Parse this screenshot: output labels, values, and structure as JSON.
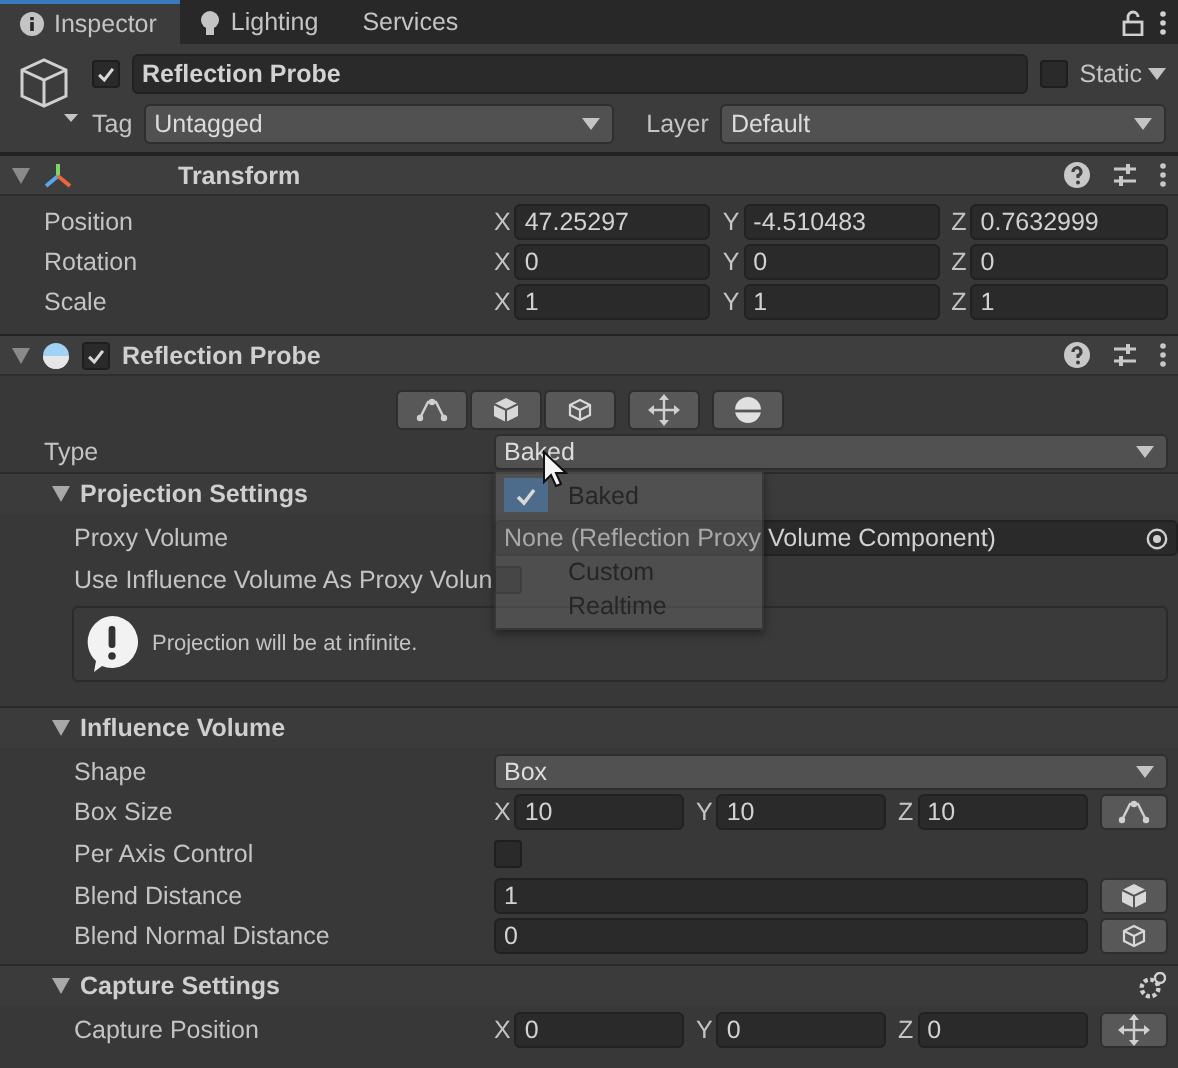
{
  "tabs": [
    {
      "label": "Inspector",
      "selected": true
    },
    {
      "label": "Lighting",
      "selected": false
    },
    {
      "label": "Services",
      "selected": false
    }
  ],
  "object": {
    "active": true,
    "name": "Reflection Probe",
    "static": false,
    "static_label": "Static",
    "tag_label": "Tag",
    "tag": "Untagged",
    "layer_label": "Layer",
    "layer": "Default"
  },
  "components": [
    {
      "title": "Transform",
      "expanded": true,
      "rows": [
        {
          "kind": "vector",
          "label": "Position",
          "values": [
            {
              "axis": "X",
              "value": "47.25297"
            },
            {
              "axis": "Y",
              "value": "-4.510483"
            },
            {
              "axis": "Z",
              "value": "0.7632999"
            }
          ]
        },
        {
          "kind": "vector",
          "label": "Rotation",
          "values": [
            {
              "axis": "X",
              "value": "0"
            },
            {
              "axis": "Y",
              "value": "0"
            },
            {
              "axis": "Z",
              "value": "0"
            }
          ]
        },
        {
          "kind": "vector",
          "label": "Scale",
          "values": [
            {
              "axis": "X",
              "value": "1"
            },
            {
              "axis": "Y",
              "value": "1"
            },
            {
              "axis": "Z",
              "value": "1"
            }
          ]
        }
      ]
    },
    {
      "title": "Reflection Probe",
      "enabled": true,
      "expanded": true,
      "toolbar": true,
      "rows": [
        {
          "kind": "dropdown",
          "label": "Type",
          "value": "Baked",
          "menu": [
            {
              "label": "Baked",
              "selected": true
            },
            {
              "label": "Custom",
              "selected": false
            },
            {
              "label": "Realtime",
              "selected": false
            }
          ]
        },
        {
          "kind": "section",
          "title": "Projection Settings",
          "expanded": true,
          "rows": [
            {
              "kind": "object",
              "label": "Proxy Volume",
              "value": "None (Reflection Proxy Volume Component)"
            },
            {
              "kind": "checkbox",
              "label": "Use Influence Volume As Proxy Volun",
              "checked": false
            },
            {
              "kind": "help",
              "text": "Projection will be at infinite."
            }
          ]
        },
        {
          "kind": "section",
          "title": "Influence Volume",
          "expanded": true,
          "rows": [
            {
              "kind": "dropdown",
              "label": "Shape",
              "value": "Box"
            },
            {
              "kind": "vector",
              "label": "Box Size",
              "button": true,
              "values": [
                {
                  "axis": "X",
                  "value": "10"
                },
                {
                  "axis": "Y",
                  "value": "10"
                },
                {
                  "axis": "Z",
                  "value": "10"
                }
              ]
            },
            {
              "kind": "checkbox",
              "label": "Per Axis Control",
              "checked": false
            },
            {
              "kind": "field",
              "label": "Blend Distance",
              "value": "1",
              "button": true
            },
            {
              "kind": "field",
              "label": "Blend Normal Distance",
              "value": "0",
              "button": true
            }
          ]
        },
        {
          "kind": "section",
          "title": "Capture Settings",
          "expanded": true,
          "settings": true,
          "rows": [
            {
              "kind": "vector",
              "label": "Capture Position",
              "button": true,
              "values": [
                {
                  "axis": "X",
                  "value": "0"
                },
                {
                  "axis": "Y",
                  "value": "0"
                },
                {
                  "axis": "Z",
                  "value": "0"
                }
              ]
            }
          ]
        }
      ]
    }
  ]
}
